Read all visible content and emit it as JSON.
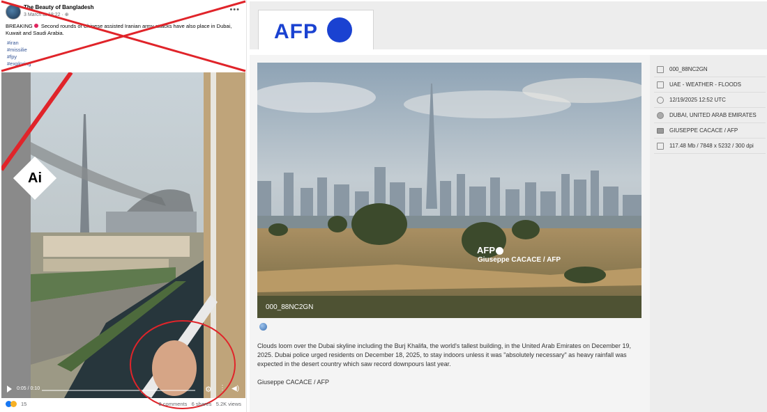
{
  "post": {
    "page_name": "The Beauty of Bangladesh",
    "meta": "3 March at 18:22 · ⊕",
    "text_prefix": "BREAKING",
    "text_body": "Second rounds of Chinese assisted Iranian army attacks have also place in Dubai, Kuwait and Saudi Arabia.",
    "hashtags": [
      "#iran",
      "#missilie",
      "#fpy",
      "#exploring"
    ],
    "badge": "Ai",
    "video_time": "0:05 / 0:10",
    "reaction_count": "15",
    "comments": "8 comments",
    "shares": "6 shares",
    "views": "5.2K views",
    "colors": {
      "cross": "#e0242a",
      "link": "#385898"
    }
  },
  "afp": {
    "logo": "AFP",
    "watermark_logo": "AFP",
    "watermark_credit": "Giuseppe CACACE / AFP",
    "photo_id": "000_88NC2GN",
    "caption": "Clouds loom over the Dubai skyline including the Burj Khalifa, the world's tallest building, in the United Arab Emirates on December 19, 2025. Dubai police urged residents on December 18, 2025, to stay indoors unless it was \"absolutely necessary\" as heavy rainfall was expected in the desert country which saw record downpours last year.",
    "byline": "Giuseppe CACACE / AFP",
    "meta": [
      {
        "icon": "document-icon",
        "text": "000_88NC2GN"
      },
      {
        "icon": "caption-icon",
        "text": "UAE - WEATHER - FLOODS"
      },
      {
        "icon": "clock-icon",
        "text": "12/19/2025 12:52 UTC"
      },
      {
        "icon": "globe-icon",
        "text": "DUBAI, UNITED ARAB EMIRATES"
      },
      {
        "icon": "camera-icon",
        "text": "GIUSEPPE CACACE / AFP"
      },
      {
        "icon": "resize-icon",
        "text": "117.48 Mb / 7848 x 5232 / 300 dpi"
      }
    ],
    "colors": {
      "brand": "#1a42d1"
    }
  }
}
